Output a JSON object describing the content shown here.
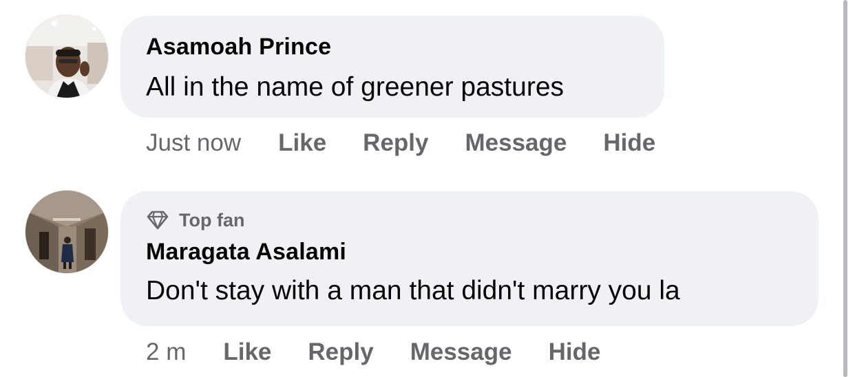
{
  "comments": [
    {
      "author": "Asamoah Prince",
      "text": "All in the name of greener pastures",
      "badge": "",
      "time": "Just now",
      "actions": {
        "like": "Like",
        "reply": "Reply",
        "message": "Message",
        "hide": "Hide"
      }
    },
    {
      "author": "Maragata Asalami",
      "text": "Don't stay with a man that didn't marry you  la",
      "badge": "Top fan",
      "time": "2 m",
      "actions": {
        "like": "Like",
        "reply": "Reply",
        "message": "Message",
        "hide": "Hide"
      }
    }
  ],
  "colors": {
    "bubble": "#f0f1f5",
    "primary_text": "#050505",
    "secondary_text": "#65676b",
    "scrollbar": "#b8b8bc"
  },
  "icons": {
    "top_fan_badge": "diamond-icon"
  }
}
